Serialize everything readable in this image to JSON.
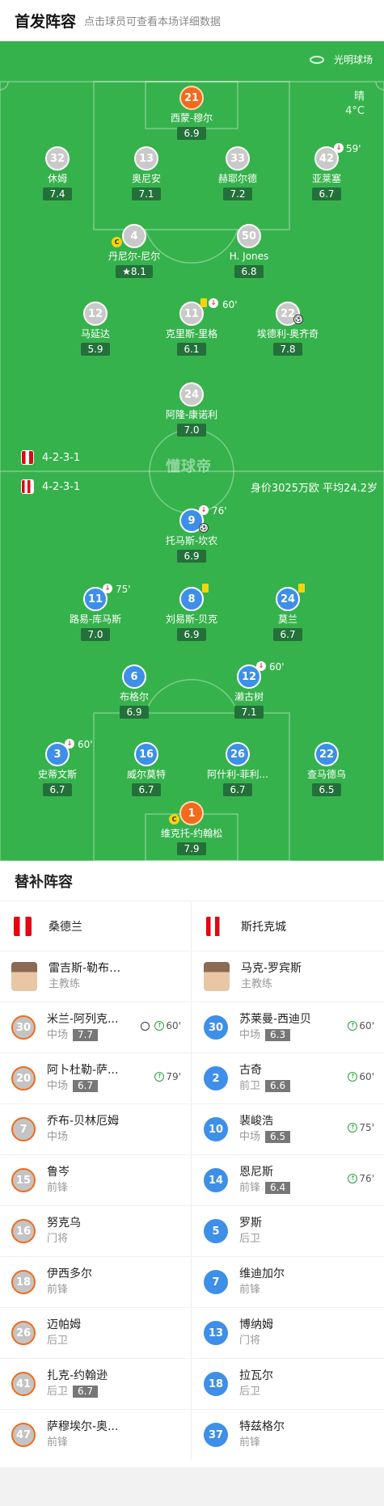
{
  "header": {
    "title": "首发阵容",
    "subtitle": "点击球员可查看本场详细数据"
  },
  "pitch": {
    "venue": "光明球场",
    "weather": {
      "condition": "晴",
      "temp": "4°C"
    },
    "home_formation": "4-2-3-1",
    "away_formation": "4-2-3-1",
    "market": "身价3025万欧 平均24.2岁",
    "watermark": "懂球帝",
    "home_players": [
      {
        "num": "21",
        "name": "西蒙-穆尔",
        "rating": "6.9"
      },
      {
        "num": "32",
        "name": "休姆",
        "rating": "7.4"
      },
      {
        "num": "13",
        "name": "奥尼安",
        "rating": "7.1"
      },
      {
        "num": "33",
        "name": "赫耶尔德",
        "rating": "7.2"
      },
      {
        "num": "42",
        "name": "亚莱塞",
        "rating": "6.7",
        "sub": "59'"
      },
      {
        "num": "4",
        "name": "丹尼尔-尼尔",
        "rating": "8.1"
      },
      {
        "num": "50",
        "name": "H. Jones",
        "rating": "6.8"
      },
      {
        "num": "12",
        "name": "马延达",
        "rating": "5.9"
      },
      {
        "num": "11",
        "name": "克里斯-里格",
        "rating": "6.1",
        "sub": "60'"
      },
      {
        "num": "22",
        "name": "埃德利-奥齐奇",
        "rating": "7.8"
      },
      {
        "num": "24",
        "name": "阿隆-康诺利",
        "rating": "7.0"
      }
    ],
    "away_players": [
      {
        "num": "9",
        "name": "托马斯-坎农",
        "rating": "6.9",
        "sub": "76'"
      },
      {
        "num": "11",
        "name": "路易-库马斯",
        "rating": "7.0",
        "sub": "75'"
      },
      {
        "num": "8",
        "name": "刘易斯-贝克",
        "rating": "6.9"
      },
      {
        "num": "24",
        "name": "莫兰",
        "rating": "6.7"
      },
      {
        "num": "6",
        "name": "布格尔",
        "rating": "6.9"
      },
      {
        "num": "12",
        "name": "濑古树",
        "rating": "7.1",
        "sub": "60'"
      },
      {
        "num": "3",
        "name": "史蒂文斯",
        "rating": "6.7",
        "sub": "60'"
      },
      {
        "num": "16",
        "name": "威尔莫特",
        "rating": "6.7"
      },
      {
        "num": "26",
        "name": "阿什利-菲利...",
        "rating": "6.7"
      },
      {
        "num": "22",
        "name": "查马德乌",
        "rating": "6.5"
      },
      {
        "num": "1",
        "name": "维克托-约翰松",
        "rating": "7.9"
      }
    ]
  },
  "subs": {
    "title": "替补阵容",
    "home": {
      "team": "桑德兰",
      "coach": {
        "name": "雷吉斯-勒布里斯",
        "role": "主教练"
      },
      "players": [
        {
          "num": "30",
          "name": "米兰-阿列克...",
          "pos": "中场",
          "rating": "7.7",
          "time": "60'",
          "goal": true
        },
        {
          "num": "20",
          "name": "阿卜杜勒-萨...",
          "pos": "中场",
          "rating": "6.7",
          "time": "79'"
        },
        {
          "num": "7",
          "name": "乔布-贝林厄姆",
          "pos": "中场"
        },
        {
          "num": "15",
          "name": "鲁岑",
          "pos": "前锋"
        },
        {
          "num": "16",
          "name": "努克乌",
          "pos": "门将"
        },
        {
          "num": "18",
          "name": "伊西多尔",
          "pos": "前锋"
        },
        {
          "num": "26",
          "name": "迈帕姆",
          "pos": "后卫"
        },
        {
          "num": "41",
          "name": "扎克-约翰逊",
          "pos": "后卫",
          "rating": "6.7"
        },
        {
          "num": "47",
          "name": "萨穆埃尔-奥...",
          "pos": "前锋"
        }
      ]
    },
    "away": {
      "team": "斯托克城",
      "coach": {
        "name": "马克-罗宾斯",
        "role": "主教练"
      },
      "players": [
        {
          "num": "30",
          "name": "苏莱曼-西迪贝",
          "pos": "中场",
          "rating": "6.3",
          "time": "60'"
        },
        {
          "num": "2",
          "name": "古奇",
          "pos": "前卫",
          "rating": "6.6",
          "time": "60'"
        },
        {
          "num": "10",
          "name": "裴峻浩",
          "pos": "中场",
          "rating": "6.5",
          "time": "75'"
        },
        {
          "num": "14",
          "name": "恩尼斯",
          "pos": "前锋",
          "rating": "6.4",
          "time": "76'"
        },
        {
          "num": "5",
          "name": "罗斯",
          "pos": "后卫"
        },
        {
          "num": "7",
          "name": "维迪加尔",
          "pos": "前锋"
        },
        {
          "num": "13",
          "name": "博纳姆",
          "pos": "门将"
        },
        {
          "num": "18",
          "name": "拉瓦尔",
          "pos": "后卫"
        },
        {
          "num": "37",
          "name": "特兹格尔",
          "pos": "前锋"
        }
      ]
    }
  }
}
